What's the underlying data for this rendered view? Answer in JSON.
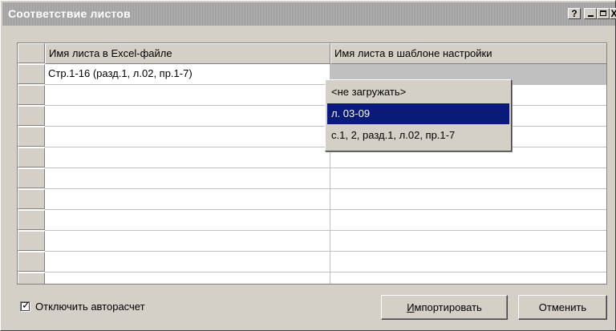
{
  "window": {
    "title": "Соответствие листов",
    "buttons": {
      "help": "?",
      "close": "X"
    }
  },
  "grid": {
    "headers": [
      "Имя листа в Excel-файле",
      "Имя листа в шаблоне настройки"
    ],
    "rows": [
      [
        "Стр.1-16 (разд.1, л.02, пр.1-7)",
        ""
      ],
      [
        "",
        ""
      ],
      [
        "",
        ""
      ],
      [
        "",
        ""
      ],
      [
        "",
        ""
      ],
      [
        "",
        ""
      ],
      [
        "",
        ""
      ],
      [
        "",
        ""
      ],
      [
        "",
        ""
      ],
      [
        "",
        ""
      ],
      [
        "",
        ""
      ]
    ]
  },
  "dropdown": {
    "options": [
      "<не загружать>",
      "л. 03-09",
      "с.1, 2, разд.1, л.02, пр.1-7"
    ],
    "selected_index": 1
  },
  "footer": {
    "checkbox_label": "Отключить авторасчет",
    "checkbox_checked": true,
    "checkbox_mark": "✓",
    "import_accel": "И",
    "import_rest": "мпортировать",
    "cancel_label": "Отменить"
  },
  "colors": {
    "selection": "#0a1a78",
    "face": "#d4d0c8"
  }
}
